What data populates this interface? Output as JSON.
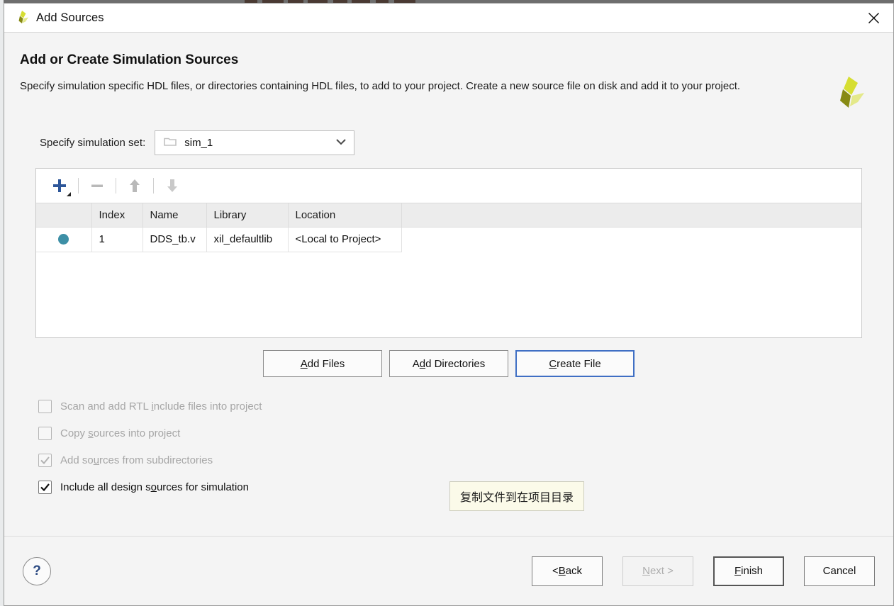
{
  "window": {
    "title": "Add Sources",
    "logo_icon": "vivado-logo-icon",
    "close_icon": "close-icon"
  },
  "header": {
    "title": "Add or Create Simulation Sources",
    "description": "Specify simulation specific HDL files, or directories containing HDL files, to add to your project. Create a new source file on disk and add it to your project.",
    "brand_icon": "vivado-logo-icon"
  },
  "simulation_set": {
    "label": "Specify simulation set:",
    "value": "sim_1",
    "folder_icon": "folder-icon",
    "chevron_icon": "chevron-down-icon"
  },
  "toolbar": {
    "add_icon": "plus-icon",
    "remove_icon": "minus-icon",
    "move_up_icon": "arrow-up-icon",
    "move_down_icon": "arrow-down-icon"
  },
  "table": {
    "columns": [
      "",
      "Index",
      "Name",
      "Library",
      "Location",
      ""
    ],
    "rows": [
      {
        "status_icon": "blue-dot-icon",
        "index": "1",
        "name": "DDS_tb.v",
        "library": "xil_defaultlib",
        "location": "<Local to Project>"
      }
    ]
  },
  "actions": {
    "add_files": {
      "pre": "A",
      "mnemonic": "",
      "label_a": "",
      "full": "Add Files",
      "m": "A",
      "rest": "dd Files"
    },
    "add_directories": {
      "full": "Add Directories",
      "pre": "A",
      "m": "d",
      "rest": "d Directories"
    },
    "create_file": {
      "full": "Create File",
      "pre": "",
      "m": "C",
      "rest": "reate File"
    }
  },
  "options": [
    {
      "id": "scan-add-rtl-include",
      "pre": "Scan and add RTL ",
      "m": "i",
      "rest": "nclude files into project",
      "checked": false,
      "enabled": false
    },
    {
      "id": "copy-sources-into-project",
      "pre": "Copy ",
      "m": "s",
      "rest": "ources into project",
      "checked": false,
      "enabled": false
    },
    {
      "id": "add-sources-from-subdirectories",
      "pre": "Add so",
      "m": "u",
      "rest": "rces from subdirectories",
      "checked": true,
      "enabled": false
    },
    {
      "id": "include-all-design-sources",
      "pre": "Include all design s",
      "m": "o",
      "rest": "urces for simulation",
      "checked": true,
      "enabled": true
    }
  ],
  "tooltip": {
    "text": "复制文件到在项目目录"
  },
  "footer": {
    "help_label": "?",
    "back": {
      "pre": "< ",
      "m": "B",
      "rest": "ack"
    },
    "next": {
      "pre": "",
      "m": "N",
      "rest": "ext >"
    },
    "finish": {
      "pre": "",
      "m": "F",
      "rest": "inish"
    },
    "cancel": {
      "pre": "",
      "m": "",
      "rest": "Cancel"
    }
  },
  "colors": {
    "accent_blue": "#3f6fc4",
    "dot_teal": "#3d8fa6",
    "plus_blue": "#2d5699",
    "help_blue": "#2b4a82",
    "tooltip_bg": "#fbfae9"
  }
}
